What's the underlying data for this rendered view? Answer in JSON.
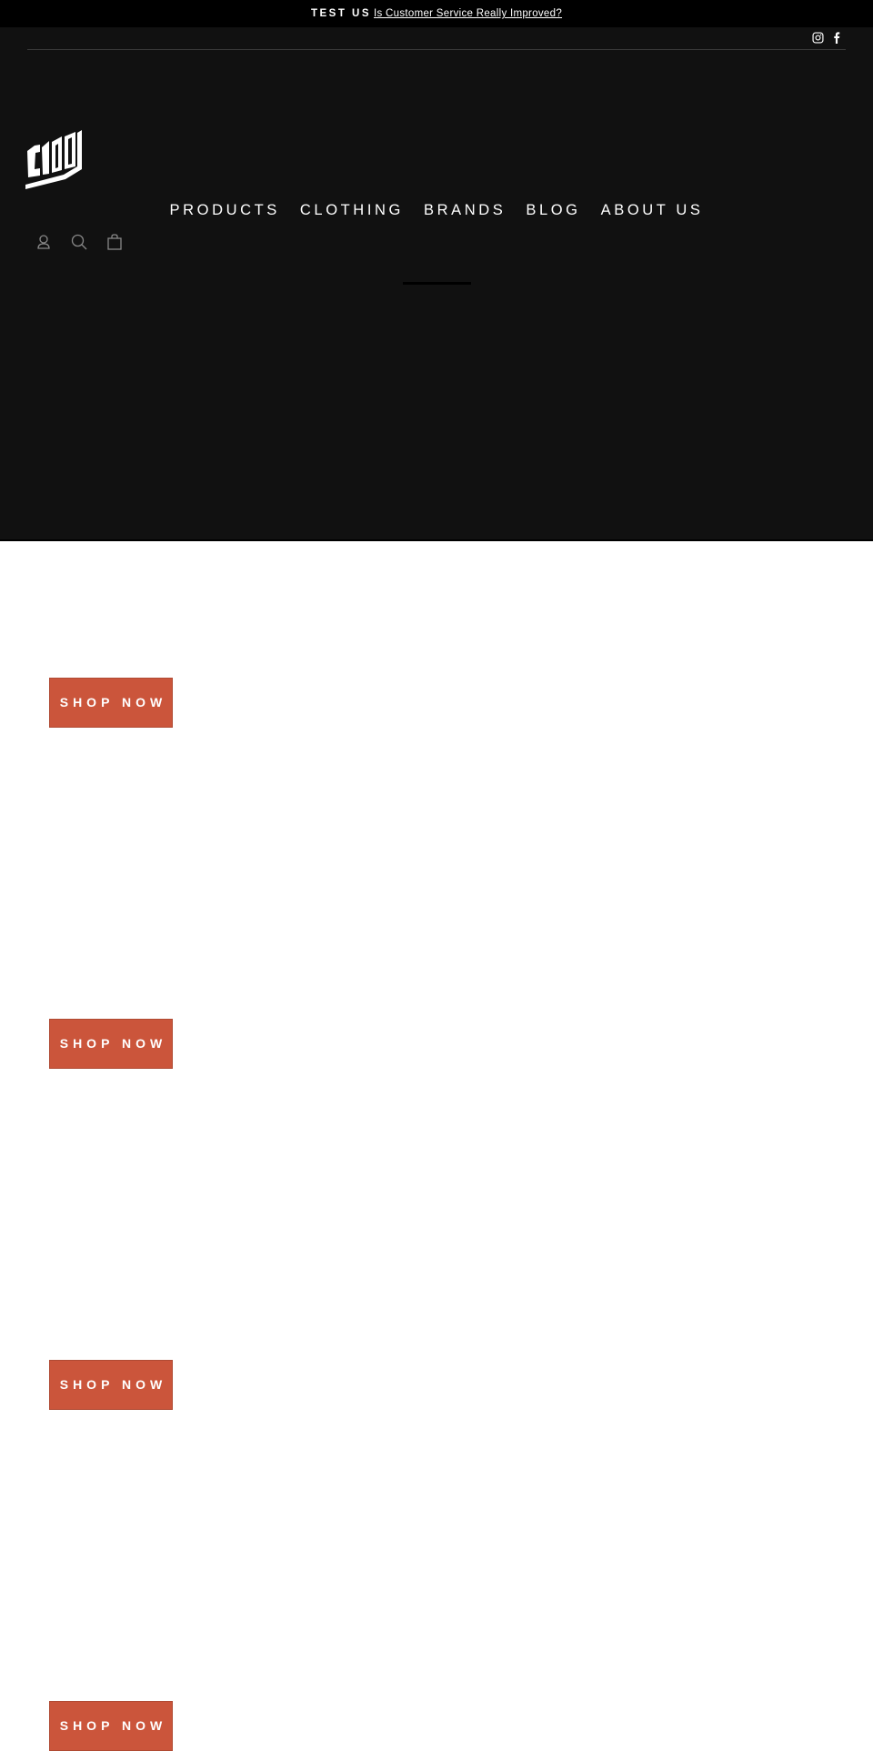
{
  "announcement": {
    "tag": "TEST US",
    "link_text": "Is Customer Service Really Improved?"
  },
  "social": [
    {
      "icon": "instagram-icon",
      "label": "Instagram"
    },
    {
      "icon": "facebook-icon",
      "label": "Facebook"
    }
  ],
  "brand": {
    "logo_text": "C100"
  },
  "nav": {
    "items": [
      {
        "label": "PRODUCTS"
      },
      {
        "label": "CLOTHING"
      },
      {
        "label": "BRANDS"
      },
      {
        "label": "BLOG"
      },
      {
        "label": "ABOUT US"
      }
    ]
  },
  "header_icons": [
    {
      "icon": "account-icon"
    },
    {
      "icon": "search-icon"
    },
    {
      "icon": "cart-icon"
    }
  ],
  "sections": [
    {
      "button_label": "SHOP NOW"
    },
    {
      "button_label": "SHOP NOW"
    },
    {
      "button_label": "SHOP NOW"
    },
    {
      "button_label": "SHOP NOW"
    }
  ],
  "colors": {
    "announcement_bg": "#000000",
    "header_bg": "#111111",
    "button_bg": "#cb553b",
    "page_bg": "#ffffff"
  }
}
